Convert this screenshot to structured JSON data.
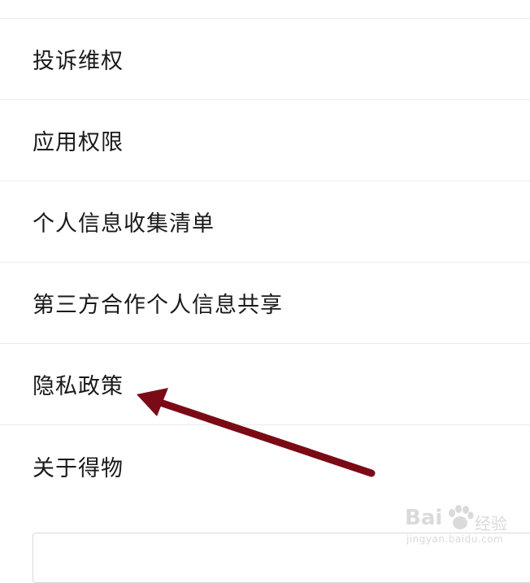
{
  "menu": {
    "items": [
      {
        "label": "投诉维权"
      },
      {
        "label": "应用权限"
      },
      {
        "label": "个人信息收集清单"
      },
      {
        "label": "第三方合作个人信息共享"
      },
      {
        "label": "隐私政策"
      },
      {
        "label": "关于得物"
      }
    ]
  },
  "annotation": {
    "arrow_color": "#7a0a16",
    "points_to": "隐私政策"
  },
  "watermark": {
    "brand": "Bai",
    "product": "经验",
    "url": "jingyan.baidu.com"
  }
}
